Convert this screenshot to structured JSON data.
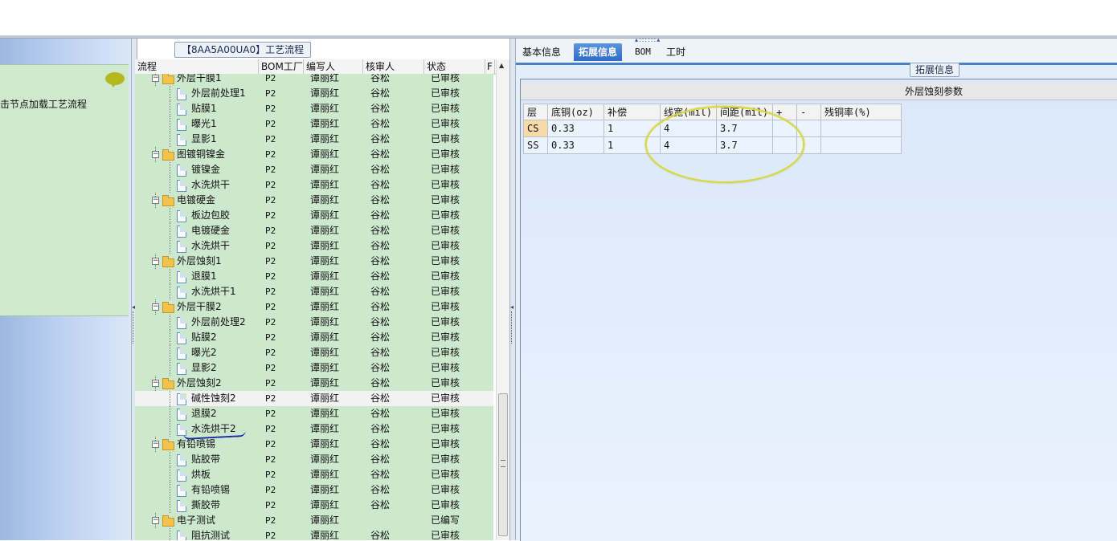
{
  "left": {
    "hint_text": "击节点加载工艺流程",
    "bubble_icon": "speech-bubble-icon"
  },
  "middle": {
    "title": "【8AA5A00UA0】工艺流程",
    "columns": [
      "流程",
      "BOM工厂",
      "编写人",
      "核审人",
      "状态",
      "F"
    ],
    "rows": [
      {
        "type": "folder",
        "name": "外层干膜1",
        "bom": "P2",
        "writer": "谭丽红",
        "reviewer": "谷松",
        "status": "已审核"
      },
      {
        "type": "doc",
        "name": "外层前处理1",
        "bom": "P2",
        "writer": "谭丽红",
        "reviewer": "谷松",
        "status": "已审核"
      },
      {
        "type": "doc",
        "name": "贴膜1",
        "bom": "P2",
        "writer": "谭丽红",
        "reviewer": "谷松",
        "status": "已审核"
      },
      {
        "type": "doc",
        "name": "曝光1",
        "bom": "P2",
        "writer": "谭丽红",
        "reviewer": "谷松",
        "status": "已审核"
      },
      {
        "type": "doc",
        "name": "显影1",
        "bom": "P2",
        "writer": "谭丽红",
        "reviewer": "谷松",
        "status": "已审核"
      },
      {
        "type": "folder",
        "name": "图镀铜镍金",
        "bom": "P2",
        "writer": "谭丽红",
        "reviewer": "谷松",
        "status": "已审核"
      },
      {
        "type": "doc",
        "name": "镀镍金",
        "bom": "P2",
        "writer": "谭丽红",
        "reviewer": "谷松",
        "status": "已审核"
      },
      {
        "type": "doc",
        "name": "水洗烘干",
        "bom": "P2",
        "writer": "谭丽红",
        "reviewer": "谷松",
        "status": "已审核"
      },
      {
        "type": "folder",
        "name": "电镀硬金",
        "bom": "P2",
        "writer": "谭丽红",
        "reviewer": "谷松",
        "status": "已审核"
      },
      {
        "type": "doc",
        "name": "板边包胶",
        "bom": "P2",
        "writer": "谭丽红",
        "reviewer": "谷松",
        "status": "已审核"
      },
      {
        "type": "doc",
        "name": "电镀硬金",
        "bom": "P2",
        "writer": "谭丽红",
        "reviewer": "谷松",
        "status": "已审核"
      },
      {
        "type": "doc",
        "name": "水洗烘干",
        "bom": "P2",
        "writer": "谭丽红",
        "reviewer": "谷松",
        "status": "已审核"
      },
      {
        "type": "folder",
        "name": "外层蚀刻1",
        "bom": "P2",
        "writer": "谭丽红",
        "reviewer": "谷松",
        "status": "已审核"
      },
      {
        "type": "doc",
        "name": "退膜1",
        "bom": "P2",
        "writer": "谭丽红",
        "reviewer": "谷松",
        "status": "已审核"
      },
      {
        "type": "doc",
        "name": "水洗烘干1",
        "bom": "P2",
        "writer": "谭丽红",
        "reviewer": "谷松",
        "status": "已审核"
      },
      {
        "type": "folder",
        "name": "外层干膜2",
        "bom": "P2",
        "writer": "谭丽红",
        "reviewer": "谷松",
        "status": "已审核"
      },
      {
        "type": "doc",
        "name": "外层前处理2",
        "bom": "P2",
        "writer": "谭丽红",
        "reviewer": "谷松",
        "status": "已审核"
      },
      {
        "type": "doc",
        "name": "贴膜2",
        "bom": "P2",
        "writer": "谭丽红",
        "reviewer": "谷松",
        "status": "已审核"
      },
      {
        "type": "doc",
        "name": "曝光2",
        "bom": "P2",
        "writer": "谭丽红",
        "reviewer": "谷松",
        "status": "已审核"
      },
      {
        "type": "doc",
        "name": "显影2",
        "bom": "P2",
        "writer": "谭丽红",
        "reviewer": "谷松",
        "status": "已审核"
      },
      {
        "type": "folder",
        "name": "外层蚀刻2",
        "bom": "P2",
        "writer": "谭丽红",
        "reviewer": "谷松",
        "status": "已审核"
      },
      {
        "type": "doc",
        "name": "碱性蚀刻2",
        "bom": "P2",
        "writer": "谭丽红",
        "reviewer": "谷松",
        "status": "已审核",
        "selected": true
      },
      {
        "type": "doc",
        "name": "退膜2",
        "bom": "P2",
        "writer": "谭丽红",
        "reviewer": "谷松",
        "status": "已审核"
      },
      {
        "type": "doc",
        "name": "水洗烘干2",
        "bom": "P2",
        "writer": "谭丽红",
        "reviewer": "谷松",
        "status": "已审核"
      },
      {
        "type": "folder",
        "name": "有铅喷锡",
        "bom": "P2",
        "writer": "谭丽红",
        "reviewer": "谷松",
        "status": "已审核"
      },
      {
        "type": "doc",
        "name": "贴胶带",
        "bom": "P2",
        "writer": "谭丽红",
        "reviewer": "谷松",
        "status": "已审核"
      },
      {
        "type": "doc",
        "name": "烘板",
        "bom": "P2",
        "writer": "谭丽红",
        "reviewer": "谷松",
        "status": "已审核"
      },
      {
        "type": "doc",
        "name": "有铅喷锡",
        "bom": "P2",
        "writer": "谭丽红",
        "reviewer": "谷松",
        "status": "已审核"
      },
      {
        "type": "doc",
        "name": "撕胶带",
        "bom": "P2",
        "writer": "谭丽红",
        "reviewer": "谷松",
        "status": "已审核"
      },
      {
        "type": "folder",
        "name": "电子测试",
        "bom": "P2",
        "writer": "谭丽红",
        "reviewer": "",
        "status": "已编写"
      },
      {
        "type": "doc",
        "name": "阻抗测试",
        "bom": "P2",
        "writer": "谭丽红",
        "reviewer": "谷松",
        "status": "已审核"
      }
    ]
  },
  "right": {
    "tabs": [
      "基本信息",
      "拓展信息",
      "BOM",
      "工时"
    ],
    "active_tab": 1,
    "group_title": "拓展信息",
    "grid_caption": "外层蚀刻参数",
    "grid_columns": [
      "层",
      "底铜(oz)",
      "补偿",
      "线宽(mil)",
      "间距(mil)",
      "+",
      "-",
      "残铜率(%)"
    ],
    "grid_rows": [
      [
        "CS",
        "0.33",
        "1",
        "4",
        "3.7",
        "",
        "",
        ""
      ],
      [
        "SS",
        "0.33",
        "1",
        "4",
        "3.7",
        "",
        "",
        ""
      ]
    ]
  },
  "colors": {
    "tree_bg": "#cde9cd",
    "active_tab": "#2f6cc8",
    "annotation_ellipse": "#d8d840",
    "ink_underline": "#1a2aa8"
  }
}
